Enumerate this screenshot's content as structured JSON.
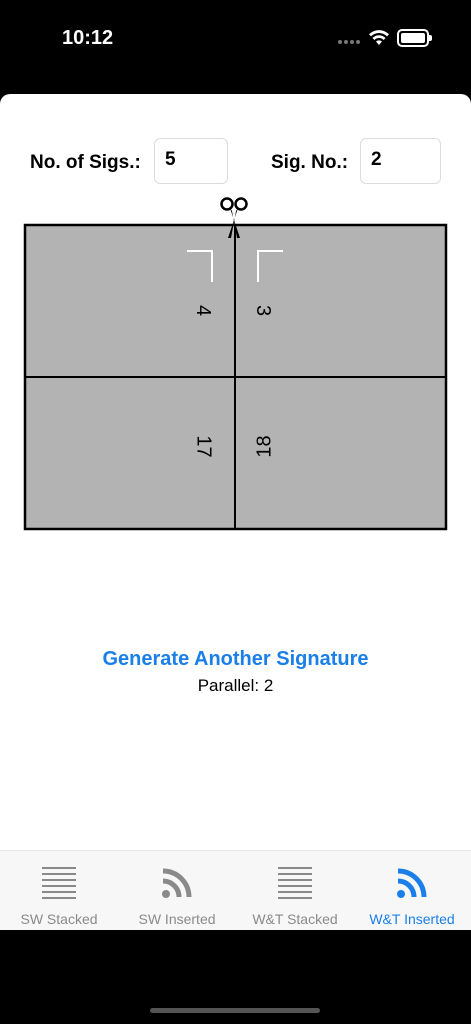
{
  "status_bar": {
    "time": "10:12"
  },
  "form": {
    "sigs_label": "No. of Sigs.:",
    "sigs_value": "5",
    "sig_no_label": "Sig. No.:",
    "sig_no_value": "2"
  },
  "diagram": {
    "pages": [
      "4",
      "3",
      "17",
      "18"
    ]
  },
  "actions": {
    "generate_label": "Generate Another Signature",
    "parallel_text": "Parallel: 2"
  },
  "tabs": [
    {
      "label": "SW Stacked",
      "icon": "lines-icon",
      "active": false
    },
    {
      "label": "SW Inserted",
      "icon": "nested-arcs-icon",
      "active": false
    },
    {
      "label": "W&T Stacked",
      "icon": "lines-icon",
      "active": false
    },
    {
      "label": "W&T Inserted",
      "icon": "nested-arcs-icon",
      "active": true
    }
  ],
  "colors": {
    "accent": "#1a7fe8",
    "sheet_fill": "#b3b3b3",
    "inactive_tab": "#8a8a8a"
  }
}
